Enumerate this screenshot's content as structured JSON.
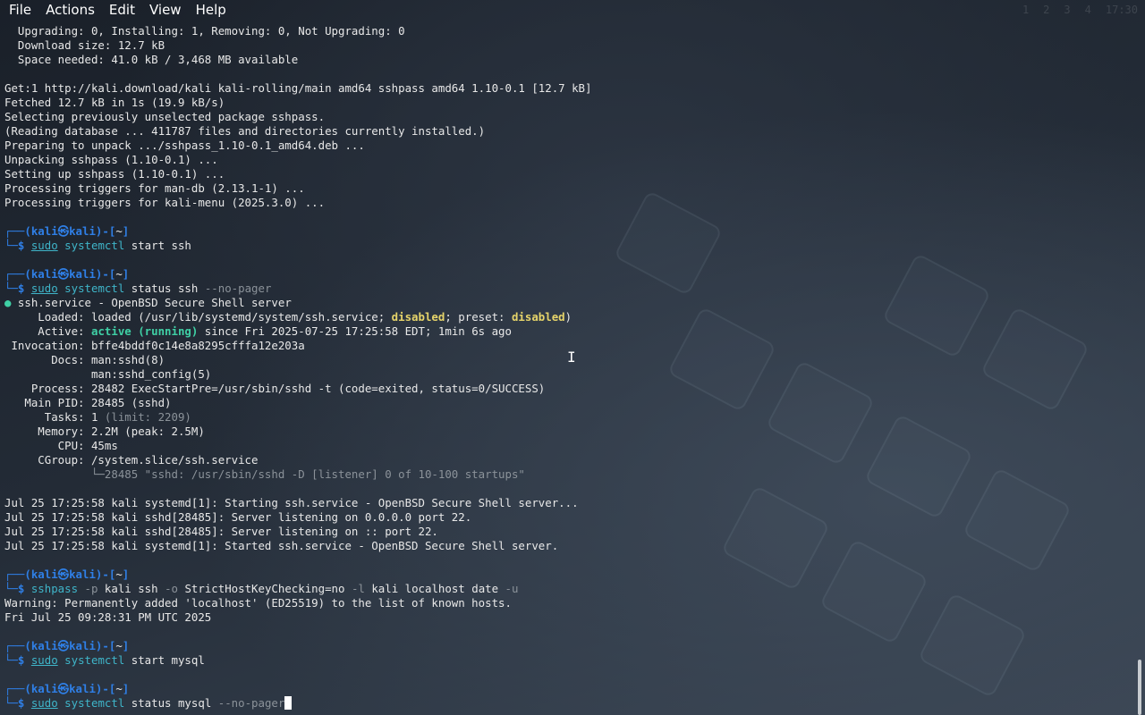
{
  "menubar": {
    "items": [
      "File",
      "Actions",
      "Edit",
      "View",
      "Help"
    ]
  },
  "tray": {
    "workspaces": [
      "1",
      "2",
      "3",
      "4"
    ],
    "clock": "17:30"
  },
  "terminal": {
    "lines": [
      [
        {
          "t": "  Upgrading: 0, Installing: 1, Removing: 0, Not Upgrading: 0",
          "c": "c-white"
        }
      ],
      [
        {
          "t": "  Download size: 12.7 kB",
          "c": "c-white"
        }
      ],
      [
        {
          "t": "  Space needed: 41.0 kB / 3,468 MB available",
          "c": "c-white"
        }
      ],
      [],
      [
        {
          "t": "Get:1 http://kali.download/kali kali-rolling/main amd64 sshpass amd64 1.10-0.1 [12.7 kB]",
          "c": "c-white"
        }
      ],
      [
        {
          "t": "Fetched 12.7 kB in 1s (19.9 kB/s)",
          "c": "c-white"
        }
      ],
      [
        {
          "t": "Selecting previously unselected package sshpass.",
          "c": "c-white"
        }
      ],
      [
        {
          "t": "(Reading database ... 411787 files and directories currently installed.)",
          "c": "c-white"
        }
      ],
      [
        {
          "t": "Preparing to unpack .../sshpass_1.10-0.1_amd64.deb ...",
          "c": "c-white"
        }
      ],
      [
        {
          "t": "Unpacking sshpass (1.10-0.1) ...",
          "c": "c-white"
        }
      ],
      [
        {
          "t": "Setting up sshpass (1.10-0.1) ...",
          "c": "c-white"
        }
      ],
      [
        {
          "t": "Processing triggers for man-db (2.13.1-1) ...",
          "c": "c-white"
        }
      ],
      [
        {
          "t": "Processing triggers for kali-menu (2025.3.0) ...",
          "c": "c-white"
        }
      ],
      [],
      [
        {
          "t": "┌──(",
          "c": "c-blue"
        },
        {
          "t": "kali㉿kali",
          "c": "c-blue"
        },
        {
          "t": ")-[",
          "c": "c-blue"
        },
        {
          "t": "~",
          "c": "c-white"
        },
        {
          "t": "]",
          "c": "c-blue"
        }
      ],
      [
        {
          "t": "└─",
          "c": "c-blue"
        },
        {
          "t": "$ ",
          "c": "c-blue"
        },
        {
          "t": "sudo",
          "c": "c-cmd ul"
        },
        {
          "t": " systemctl",
          "c": "c-cmd"
        },
        {
          "t": " start ssh",
          "c": "c-white"
        }
      ],
      [],
      [
        {
          "t": "┌──(",
          "c": "c-blue"
        },
        {
          "t": "kali㉿kali",
          "c": "c-blue"
        },
        {
          "t": ")-[",
          "c": "c-blue"
        },
        {
          "t": "~",
          "c": "c-white"
        },
        {
          "t": "]",
          "c": "c-blue"
        }
      ],
      [
        {
          "t": "└─",
          "c": "c-blue"
        },
        {
          "t": "$ ",
          "c": "c-blue"
        },
        {
          "t": "sudo",
          "c": "c-cmd ul"
        },
        {
          "t": " systemctl",
          "c": "c-cmd"
        },
        {
          "t": " status ssh ",
          "c": "c-white"
        },
        {
          "t": "--no-pager",
          "c": "c-dim"
        }
      ],
      [
        {
          "t": "● ",
          "c": "c-green"
        },
        {
          "t": "ssh.service - OpenBSD Secure Shell server",
          "c": "c-white"
        }
      ],
      [
        {
          "t": "     Loaded: loaded (/usr/lib/systemd/system/ssh.service; ",
          "c": "c-white"
        },
        {
          "t": "disabled",
          "c": "c-yellow"
        },
        {
          "t": "; preset: ",
          "c": "c-white"
        },
        {
          "t": "disabled",
          "c": "c-yellow"
        },
        {
          "t": ")",
          "c": "c-white"
        }
      ],
      [
        {
          "t": "     Active: ",
          "c": "c-white"
        },
        {
          "t": "active (running)",
          "c": "c-green"
        },
        {
          "t": " since Fri 2025-07-25 17:25:58 EDT; 1min 6s ago",
          "c": "c-white"
        }
      ],
      [
        {
          "t": " Invocation: bffe4bddf0c14e8a8295cfffa12e203a",
          "c": "c-white"
        }
      ],
      [
        {
          "t": "       Docs: man:sshd(8)",
          "c": "c-white"
        }
      ],
      [
        {
          "t": "             man:sshd_config(5)",
          "c": "c-white"
        }
      ],
      [
        {
          "t": "    Process: 28482 ExecStartPre=/usr/sbin/sshd -t (code=exited, status=0/SUCCESS)",
          "c": "c-white"
        }
      ],
      [
        {
          "t": "   Main PID: 28485 (sshd)",
          "c": "c-white"
        }
      ],
      [
        {
          "t": "      Tasks: 1 ",
          "c": "c-white"
        },
        {
          "t": "(limit: 2209)",
          "c": "c-dim"
        }
      ],
      [
        {
          "t": "     Memory: 2.2M (peak: 2.5M)",
          "c": "c-white"
        }
      ],
      [
        {
          "t": "        CPU: 45ms",
          "c": "c-white"
        }
      ],
      [
        {
          "t": "     CGroup: /system.slice/ssh.service",
          "c": "c-white"
        }
      ],
      [
        {
          "t": "             └─28485 \"sshd: /usr/sbin/sshd -D [listener] 0 of 10-100 startups\"",
          "c": "c-dim"
        }
      ],
      [],
      [
        {
          "t": "Jul 25 17:25:58 kali systemd[1]: Starting ssh.service - OpenBSD Secure Shell server...",
          "c": "c-white"
        }
      ],
      [
        {
          "t": "Jul 25 17:25:58 kali sshd[28485]: Server listening on 0.0.0.0 port 22.",
          "c": "c-white"
        }
      ],
      [
        {
          "t": "Jul 25 17:25:58 kali sshd[28485]: Server listening on :: port 22.",
          "c": "c-white"
        }
      ],
      [
        {
          "t": "Jul 25 17:25:58 kali systemd[1]: Started ssh.service - OpenBSD Secure Shell server.",
          "c": "c-white"
        }
      ],
      [],
      [
        {
          "t": "┌──(",
          "c": "c-blue"
        },
        {
          "t": "kali㉿kali",
          "c": "c-blue"
        },
        {
          "t": ")-[",
          "c": "c-blue"
        },
        {
          "t": "~",
          "c": "c-white"
        },
        {
          "t": "]",
          "c": "c-blue"
        }
      ],
      [
        {
          "t": "└─",
          "c": "c-blue"
        },
        {
          "t": "$ ",
          "c": "c-blue"
        },
        {
          "t": "sshpass",
          "c": "c-cmd"
        },
        {
          "t": " -p",
          "c": "c-dim"
        },
        {
          "t": " kali ssh ",
          "c": "c-white"
        },
        {
          "t": "-o",
          "c": "c-dim"
        },
        {
          "t": " StrictHostKeyChecking=no ",
          "c": "c-white"
        },
        {
          "t": "-l",
          "c": "c-dim"
        },
        {
          "t": " kali localhost date ",
          "c": "c-white"
        },
        {
          "t": "-u",
          "c": "c-dim"
        }
      ],
      [
        {
          "t": "Warning: Permanently added 'localhost' (ED25519) to the list of known hosts.",
          "c": "c-white"
        }
      ],
      [
        {
          "t": "Fri Jul 25 09:28:31 PM UTC 2025",
          "c": "c-white"
        }
      ],
      [],
      [
        {
          "t": "┌──(",
          "c": "c-blue"
        },
        {
          "t": "kali㉿kali",
          "c": "c-blue"
        },
        {
          "t": ")-[",
          "c": "c-blue"
        },
        {
          "t": "~",
          "c": "c-white"
        },
        {
          "t": "]",
          "c": "c-blue"
        }
      ],
      [
        {
          "t": "└─",
          "c": "c-blue"
        },
        {
          "t": "$ ",
          "c": "c-blue"
        },
        {
          "t": "sudo",
          "c": "c-cmd ul"
        },
        {
          "t": " systemctl",
          "c": "c-cmd"
        },
        {
          "t": " start mysql",
          "c": "c-white"
        }
      ],
      [],
      [
        {
          "t": "┌──(",
          "c": "c-blue"
        },
        {
          "t": "kali㉿kali",
          "c": "c-blue"
        },
        {
          "t": ")-[",
          "c": "c-blue"
        },
        {
          "t": "~",
          "c": "c-white"
        },
        {
          "t": "]",
          "c": "c-blue"
        }
      ],
      [
        {
          "t": "└─",
          "c": "c-blue"
        },
        {
          "t": "$ ",
          "c": "c-blue"
        },
        {
          "t": "sudo",
          "c": "c-cmd ul"
        },
        {
          "t": " systemctl",
          "c": "c-cmd"
        },
        {
          "t": " status mysql ",
          "c": "c-white"
        },
        {
          "t": "--no-pager",
          "c": "c-dim"
        }
      ]
    ]
  },
  "colors": {
    "prompt": "#2f7fe6",
    "command": "#3fb5c9",
    "active": "#3fd0a5",
    "warning": "#e6d46a",
    "dim": "#8b9299"
  }
}
